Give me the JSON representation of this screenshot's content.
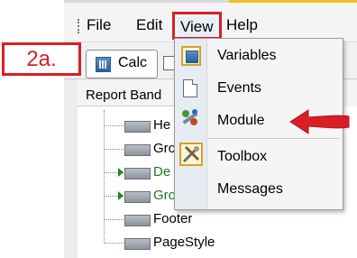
{
  "step_label": "2a.",
  "menubar": {
    "items": [
      "File",
      "Edit",
      "View",
      "Help"
    ]
  },
  "toolbar": {
    "calc_label": "Calc"
  },
  "panel": {
    "header": "Report Band",
    "bands": [
      {
        "label": "He",
        "color": "#000000",
        "arrow": false
      },
      {
        "label": "Gro",
        "color": "#000000",
        "arrow": false
      },
      {
        "label": "De",
        "color": "#1a7a1a",
        "arrow": true
      },
      {
        "label": "Gro",
        "color": "#1a7a1a",
        "arrow": true
      },
      {
        "label": "Footer",
        "color": "#000000",
        "arrow": false
      },
      {
        "label": "PageStyle",
        "color": "#000000",
        "arrow": false
      }
    ]
  },
  "view_menu": {
    "items": [
      "Variables",
      "Events",
      "Module",
      "Toolbox",
      "Messages"
    ],
    "icons": [
      "variables-icon",
      "events-icon",
      "module-icon",
      "toolbox-icon",
      ""
    ]
  },
  "colors": {
    "highlight_red": "#d81f26",
    "tree_green": "#1a7a1a"
  }
}
